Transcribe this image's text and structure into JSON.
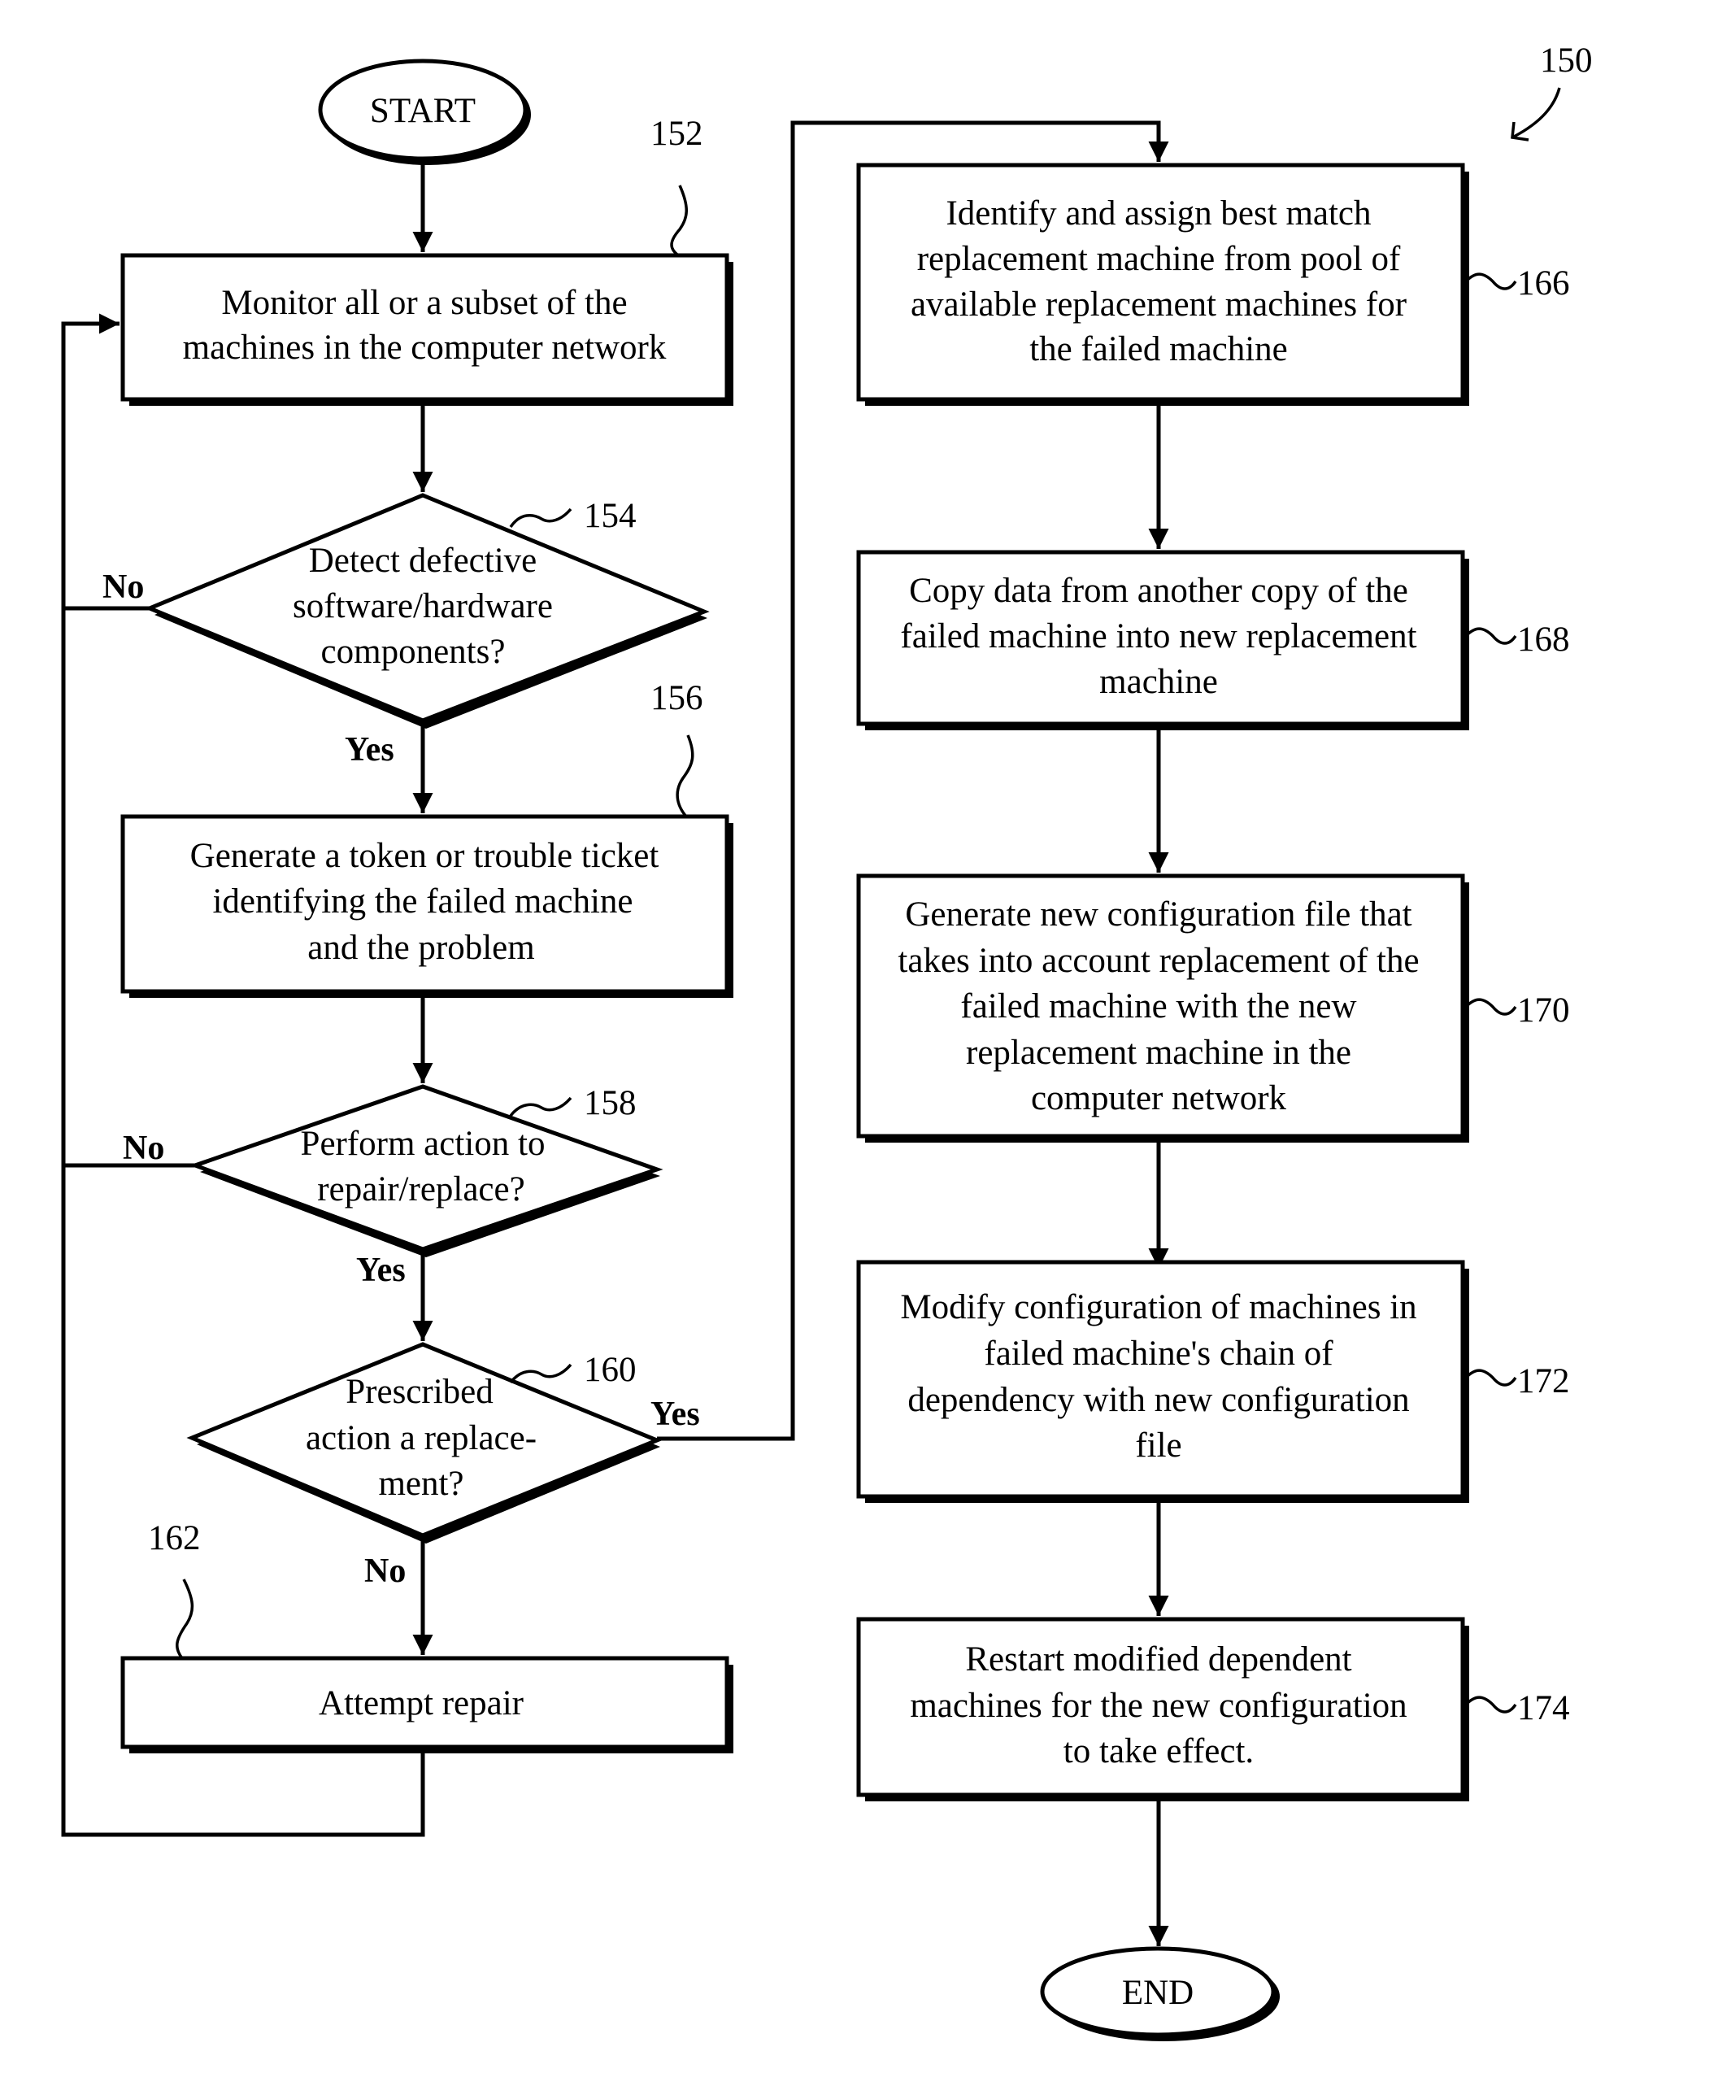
{
  "figure": {
    "reference": "150",
    "start_label": "START",
    "end_label": "END"
  },
  "steps": {
    "s152": {
      "ref": "152",
      "lines": [
        "Monitor all or a subset of the",
        "machines in the computer network"
      ]
    },
    "s154": {
      "ref": "154",
      "lines": [
        "Detect defective",
        "software/hardware",
        "components?"
      ]
    },
    "s156": {
      "ref": "156",
      "lines": [
        "Generate a token or trouble ticket",
        "identifying the failed machine",
        "and the problem"
      ]
    },
    "s158": {
      "ref": "158",
      "lines": [
        "Perform action to",
        "repair/replace?"
      ]
    },
    "s160": {
      "ref": "160",
      "lines": [
        "Prescribed",
        "action a replace-",
        "ment?"
      ]
    },
    "s162": {
      "ref": "162",
      "lines": [
        "Attempt repair"
      ]
    },
    "s166": {
      "ref": "166",
      "lines": [
        "Identify and assign best match",
        "replacement machine from pool of",
        "available replacement machines for",
        "the failed machine"
      ]
    },
    "s168": {
      "ref": "168",
      "lines": [
        "Copy data from another copy of the",
        "failed machine into new replacement",
        "machine"
      ]
    },
    "s170": {
      "ref": "170",
      "lines": [
        "Generate new configuration file that",
        "takes into account replacement of the",
        "failed machine with the new",
        "replacement machine in the",
        "computer network"
      ]
    },
    "s172": {
      "ref": "172",
      "lines": [
        "Modify configuration of machines in",
        "failed machine's chain of",
        "dependency with new configuration",
        "file"
      ]
    },
    "s174": {
      "ref": "174",
      "lines": [
        "Restart modified dependent",
        "machines for the new configuration",
        "to take effect."
      ]
    }
  },
  "branches": {
    "d154_no": "No",
    "d154_yes": "Yes",
    "d158_no": "No",
    "d158_yes": "Yes",
    "d160_yes": "Yes",
    "d160_no": "No"
  }
}
